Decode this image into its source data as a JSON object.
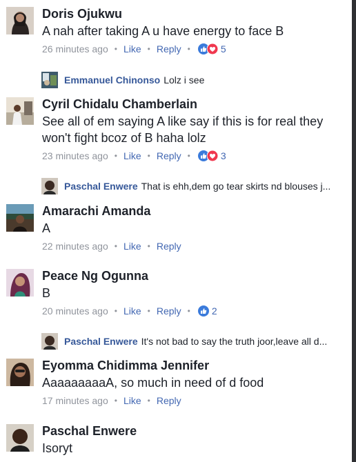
{
  "ui": {
    "like_label": "Like",
    "reply_label": "Reply",
    "separator": "•"
  },
  "comments": [
    {
      "name": "Doris Ojukwu",
      "text": "A nah after taking A u have energy  to face B",
      "time": "26 minutes ago",
      "reactions": "5"
    },
    {
      "name": "Cyril Chidalu Chamberlain",
      "text": "See all of em saying A like say if this is for real they won't fight bcoz of B haha lolz",
      "time": "23 minutes ago",
      "reactions": "3"
    },
    {
      "name": "Amarachi Amanda",
      "text": "A",
      "time": "22 minutes ago"
    },
    {
      "name": "Peace Ng Ogunna",
      "text": "B",
      "time": "20 minutes ago",
      "reactions": "2"
    },
    {
      "name": "Eyomma Chidimma Jennifer",
      "text": "AaaaaaaaaA, so much in need of d food",
      "time": "17 minutes ago"
    },
    {
      "name": "Paschal Enwere",
      "text": "Isoryt"
    }
  ],
  "replies": [
    {
      "name": "Emmanuel Chinonso",
      "text": "Lolz i see"
    },
    {
      "name": "Paschal Enwere",
      "text": "That is ehh,dem go tear skirts nd blouses j..."
    },
    {
      "name": "Paschal Enwere",
      "text": "It's not bad to say the truth joor,leave all d..."
    }
  ],
  "icons": {
    "like": "like-reaction-icon",
    "love": "love-reaction-icon",
    "like_color": "#3b7bdb",
    "love_color": "#f0384f"
  }
}
